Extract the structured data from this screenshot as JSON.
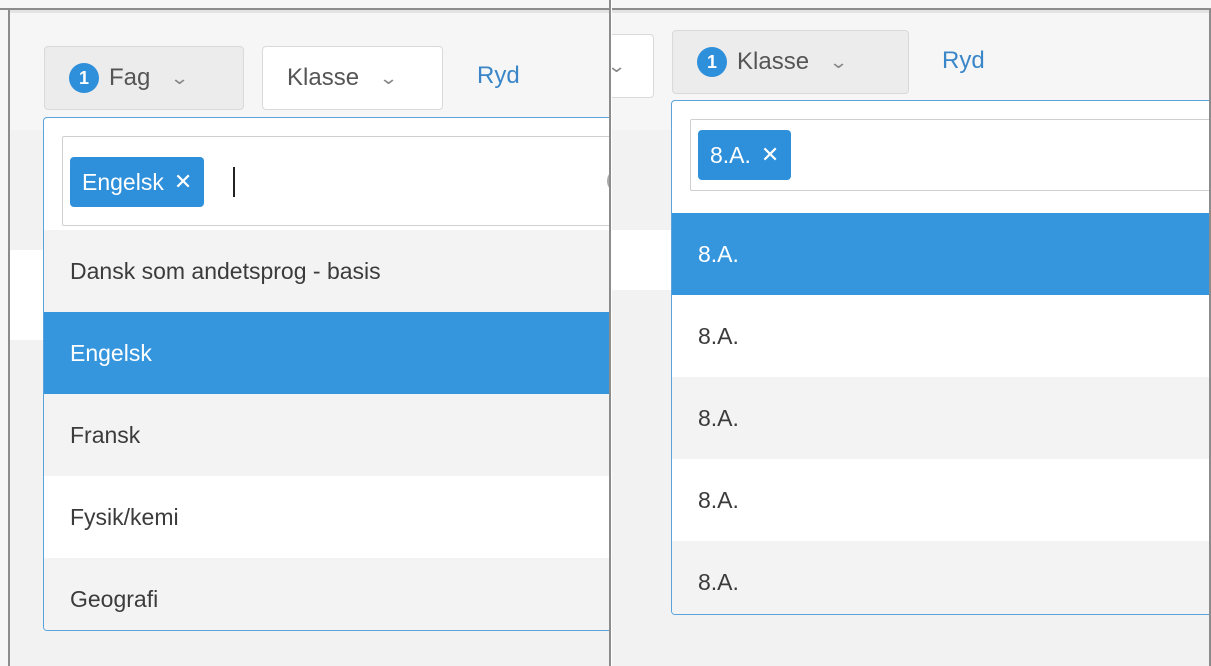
{
  "left": {
    "subject_filter": {
      "badge": "1",
      "label": "Fag",
      "chevron": "chevron-down-icon"
    },
    "class_filter": {
      "label": "Klasse",
      "chevron": "chevron-down-icon"
    },
    "clear_link": "Ryd",
    "search": {
      "tag_label": "Engelsk",
      "tag_remove": "✕"
    },
    "options": [
      "Dansk som andetsprog - basis",
      "Engelsk",
      "Fransk",
      "Fysik/kemi",
      "Geografi"
    ],
    "selected_index": 1
  },
  "right": {
    "class_filter": {
      "badge": "1",
      "label": "Klasse",
      "chevron": "chevron-down-icon"
    },
    "clear_link": "Ryd",
    "search": {
      "tag_label": "8.A.",
      "tag_remove": "✕"
    },
    "options": [
      "8.A.",
      "8.A.",
      "8.A.",
      "8.A.",
      "8.A."
    ],
    "selected_index": 0
  },
  "colors": {
    "accent": "#3596dd",
    "link": "#3a86c8",
    "dropdown_border": "#5aa3db"
  }
}
